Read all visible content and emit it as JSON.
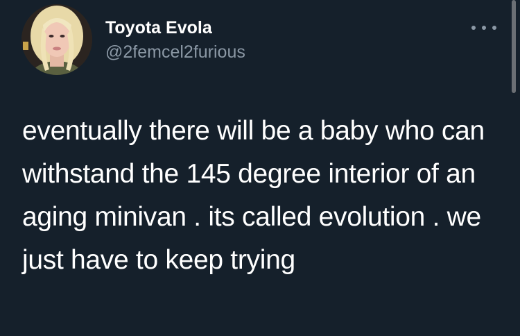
{
  "tweet": {
    "author": {
      "display_name": "Toyota Evola",
      "handle": "@2femcel2furious",
      "avatar": "profile-photo"
    },
    "text": "eventually there will be a baby who can withstand the 145 degree interior of an aging minivan . its called evolution . we just have to keep trying",
    "more_icon": "more-dots-icon"
  },
  "colors": {
    "background": "#15202b",
    "text_primary": "#ffffff",
    "text_secondary": "#8b98a5"
  }
}
